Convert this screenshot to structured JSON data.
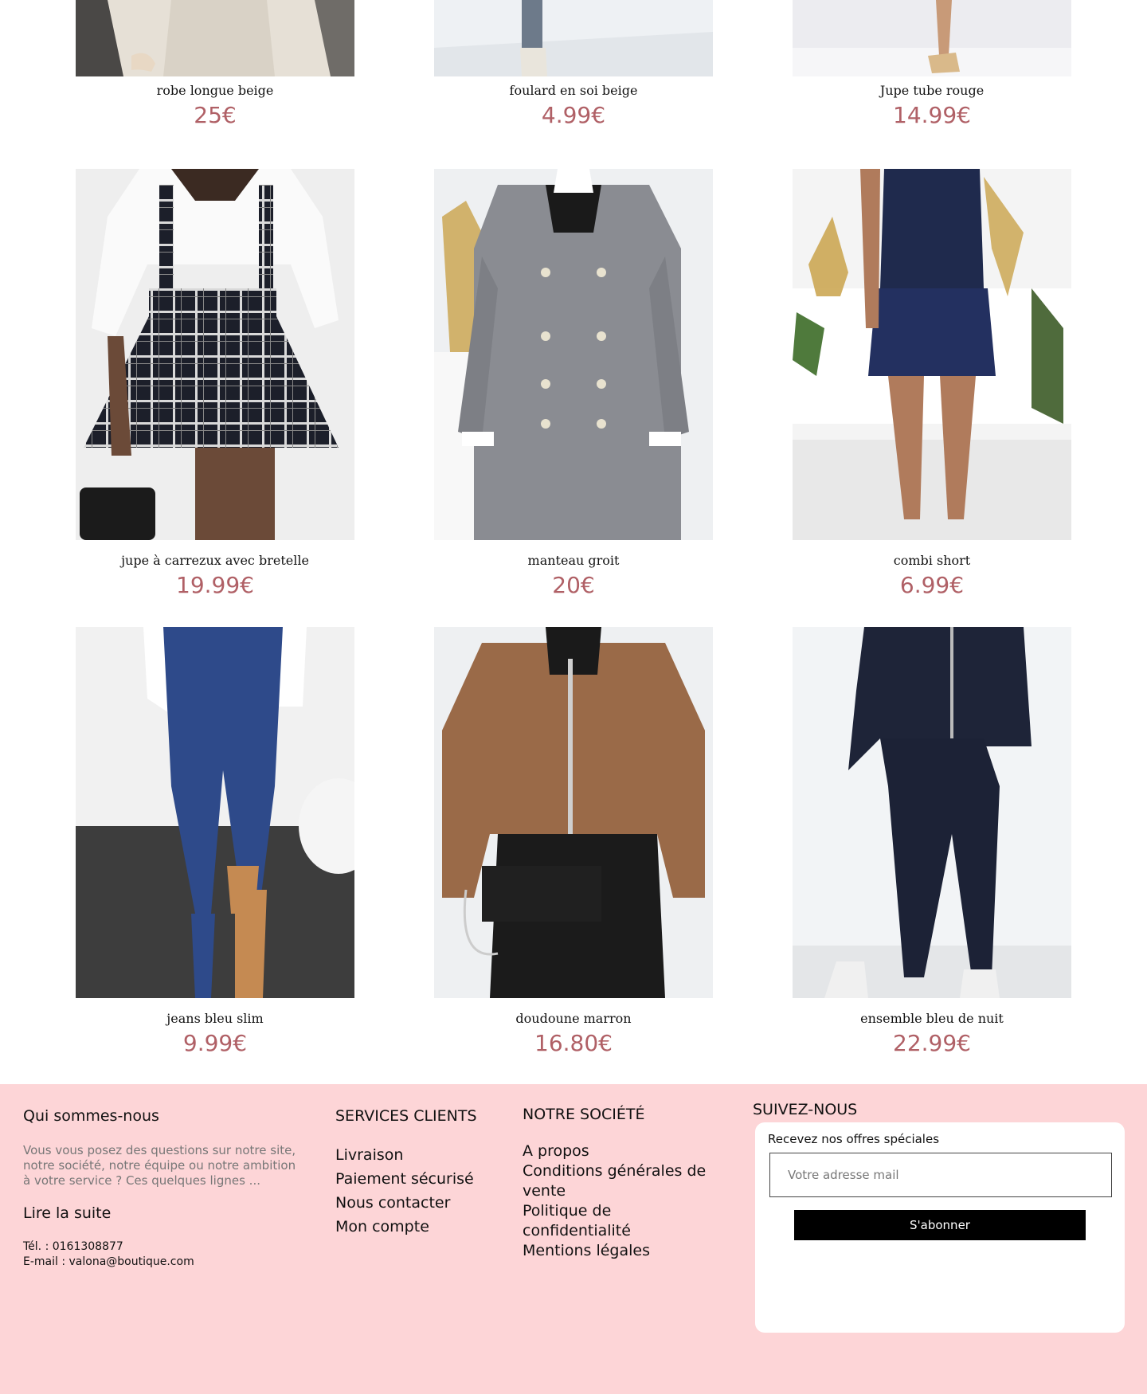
{
  "products": [
    {
      "name": "robe longue beige",
      "price": "25€",
      "image": "beige-long-dress-photo"
    },
    {
      "name": "foulard en soi beige",
      "price": "4.99€",
      "image": "beige-silk-scarf-photo"
    },
    {
      "name": "Jupe tube rouge",
      "price": "14.99€",
      "image": "red-tube-skirt-photo"
    },
    {
      "name": "jupe à carrezux avec bretelle",
      "price": "19.99€",
      "image": "plaid-suspender-skirt-photo"
    },
    {
      "name": "manteau groit",
      "price": "20€",
      "image": "grey-coat-photo"
    },
    {
      "name": "combi short",
      "price": "6.99€",
      "image": "navy-playsuit-photo"
    },
    {
      "name": "jeans bleu slim",
      "price": "9.99€",
      "image": "blue-slim-jeans-photo"
    },
    {
      "name": "doudoune marron",
      "price": "16.80€",
      "image": "brown-puffer-jacket-photo"
    },
    {
      "name": "ensemble bleu de nuit",
      "price": "22.99€",
      "image": "navy-tracksuit-photo"
    }
  ],
  "footer": {
    "about": {
      "title": "Qui sommes-nous",
      "text": "Vous vous posez des questions sur notre site, notre société, notre équipe ou notre ambition à votre service ? Ces quelques lignes ...",
      "read_more": "Lire la suite",
      "phone": "Tél. : 0161308877",
      "email": "E-mail : valona@boutique.com"
    },
    "services": {
      "title": "SERVICES CLIENTS",
      "links": [
        "Livraison",
        "Paiement sécurisé",
        "Nous contacter",
        "Mon compte"
      ]
    },
    "company": {
      "title": "NOTRE SOCIÉTÉ",
      "links": [
        "A propos",
        "Conditions générales de vente",
        "Politique de confidentialité",
        "Mentions légales"
      ]
    },
    "follow": {
      "title": "SUIVEZ-NOUS",
      "newsletter_label": "Recevez nos offres spéciales",
      "email_placeholder": "Votre adresse mail",
      "subscribe_label": "S'abonner"
    }
  },
  "colors": {
    "price": "#b06066",
    "footer_bg": "#fdd5d7",
    "button_bg": "#000000"
  }
}
